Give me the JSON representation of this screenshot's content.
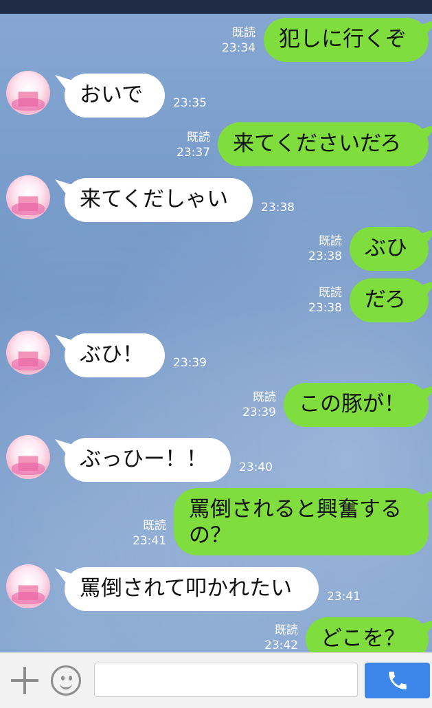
{
  "messages": [
    {
      "side": "out",
      "text": "犯しに行くぞ",
      "read": "既読",
      "time": "23:34"
    },
    {
      "side": "in",
      "text": "おいで",
      "time": "23:35"
    },
    {
      "side": "out",
      "text": "来てくださいだろ",
      "read": "既読",
      "time": "23:37"
    },
    {
      "side": "in",
      "text": "来てくだしゃい",
      "time": "23:38"
    },
    {
      "side": "out",
      "text": "ぶひ",
      "read": "既読",
      "time": "23:38"
    },
    {
      "side": "out",
      "text": "だろ",
      "read": "既読",
      "time": "23:38"
    },
    {
      "side": "in",
      "text": "ぶひ！",
      "time": "23:39"
    },
    {
      "side": "out",
      "text": "この豚が！",
      "read": "既読",
      "time": "23:39"
    },
    {
      "side": "in",
      "text": "ぶっひー！！",
      "time": "23:40"
    },
    {
      "side": "out",
      "text": "罵倒されると興奮するの？",
      "read": "既読",
      "time": "23:41"
    },
    {
      "side": "in",
      "text": "罵倒されて叩かれたい",
      "time": "23:41"
    },
    {
      "side": "out",
      "text": "どこを？",
      "read": "既読",
      "time": "23:42"
    }
  ],
  "input": {
    "value": "",
    "placeholder": ""
  },
  "icons": {
    "add": "plus-icon",
    "sticker": "emoji-icon",
    "call": "phone-icon"
  },
  "colors": {
    "outgoing": "#7fdd3e",
    "incoming": "#ffffff",
    "call_button": "#3b86e8"
  }
}
